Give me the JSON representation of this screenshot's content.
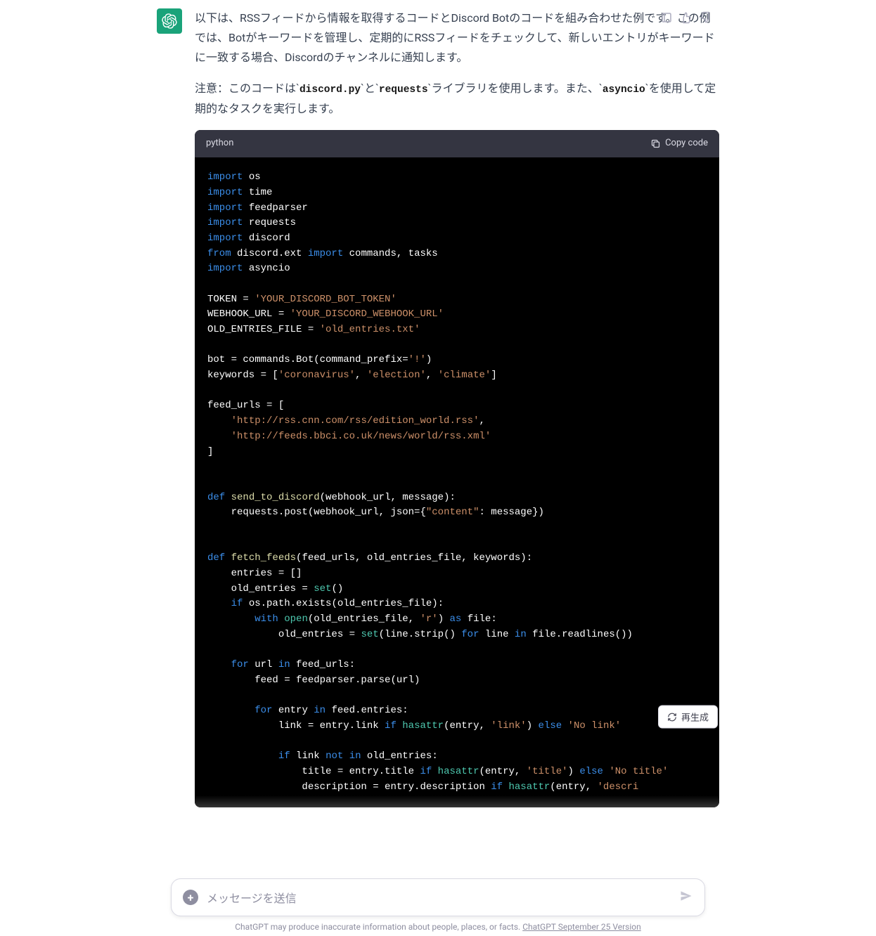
{
  "message": {
    "paragraph1": "以下は、RSSフィードから情報を取得するコードとDiscord Botのコードを組み合わせた例です。この例では、Botがキーワードを管理し、定期的にRSSフィードをチェックして、新しいエントリがキーワードに一致する場合、Discordのチャンネルに通知します。",
    "paragraph2_prefix": "注意：このコードは",
    "lib1": "discord.py",
    "paragraph2_mid1": "と",
    "lib2": "requests",
    "paragraph2_mid2": "ライブラリを使用します。また、",
    "lib3": "asyncio",
    "paragraph2_suffix": "を使用して定期的なタスクを実行します。"
  },
  "code": {
    "language": "python",
    "copy_label": "Copy code",
    "tokens": {
      "kw_import": "import",
      "kw_from": "from",
      "kw_def": "def",
      "kw_if": "if",
      "kw_with": "with",
      "kw_as": "as",
      "kw_for": "for",
      "kw_in": "in",
      "kw_not": "not",
      "kw_else": "else",
      "id_os": " os",
      "id_time": " time",
      "id_feedparser": " feedparser",
      "id_requests": " requests",
      "id_discord": " discord",
      "id_discord_ext": " discord.ext ",
      "id_commands_tasks": " commands, tasks",
      "id_asyncio": " asyncio",
      "l_token": "TOKEN = ",
      "s_token": "'YOUR_DISCORD_BOT_TOKEN'",
      "l_webhook": "WEBHOOK_URL = ",
      "s_webhook": "'YOUR_DISCORD_WEBHOOK_URL'",
      "l_oldfile": "OLD_ENTRIES_FILE = ",
      "s_oldfile": "'old_entries.txt'",
      "l_bot": "bot = commands.Bot(command_prefix=",
      "s_prefix": "'!'",
      "l_bot_end": ")",
      "l_keywords": "keywords = [",
      "s_kw1": "'coronavirus'",
      "s_kw2": "'election'",
      "s_kw3": "'climate'",
      "l_keywords_end": "]",
      "l_feeds_open": "feed_urls = [",
      "s_feed1": "'http://rss.cnn.com/rss/edition_world.rss'",
      "s_feed2": "'http://feeds.bbci.co.uk/news/world/rss.xml'",
      "l_feeds_close": "]",
      "fn_send": "send_to_discord",
      "l_send_args": "(webhook_url, message):",
      "l_send_body": "    requests.post(webhook_url, json={",
      "s_content": "\"content\"",
      "l_send_body_end": ": message})",
      "fn_fetch": "fetch_feeds",
      "l_fetch_args": "(feed_urls, old_entries_file, keywords):",
      "l_entries": "    entries = []",
      "l_old_entries_pre": "    old_entries = ",
      "bi_set": "set",
      "l_old_entries_post": "()",
      "l_if_exists_pre": "    ",
      "l_if_exists_post": " os.path.exists(old_entries_file):",
      "l_with_pre": "        ",
      "bi_open": "open",
      "l_with_args": "(old_entries_file, ",
      "s_r": "'r'",
      "l_with_post": ") ",
      "l_with_file": " file:",
      "l_setline_pre": "            old_entries = ",
      "l_setline_mid": "(line.strip() ",
      "l_setline_line": " line ",
      "l_setline_end": " file.readlines())",
      "l_for_url_pre": "    ",
      "l_for_url_mid": " url ",
      "l_for_url_end": " feed_urls:",
      "l_feedparse": "        feed = feedparser.parse(url)",
      "l_for_entry_pre": "        ",
      "l_for_entry_mid": " entry ",
      "l_for_entry_end": " feed.entries:",
      "l_link_pre": "            link = entry.link ",
      "bi_hasattr": "hasattr",
      "l_link_mid1": "(entry, ",
      "s_link": "'link'",
      "l_link_mid2": ") ",
      "s_nolink": "'No link'",
      "l_ifnot_pre": "            ",
      "l_ifnot_mid1": " link ",
      "l_ifnot_mid2": " ",
      "l_ifnot_end": " old_entries:",
      "l_title_pre": "                title = entry.title ",
      "l_title_mid1": "(entry, ",
      "s_title": "'title'",
      "l_title_mid2": ") ",
      "s_notitle": "'No title'",
      "l_desc_pre": "                description = entry.description ",
      "l_desc_mid1": "(entry, ",
      "s_descr": "'descri"
    }
  },
  "buttons": {
    "regenerate": "再生成"
  },
  "input": {
    "placeholder": "メッセージを送信"
  },
  "footer": {
    "text": "ChatGPT may produce inaccurate information about people, places, or facts. ",
    "link_text": "ChatGPT September 25 Version"
  }
}
